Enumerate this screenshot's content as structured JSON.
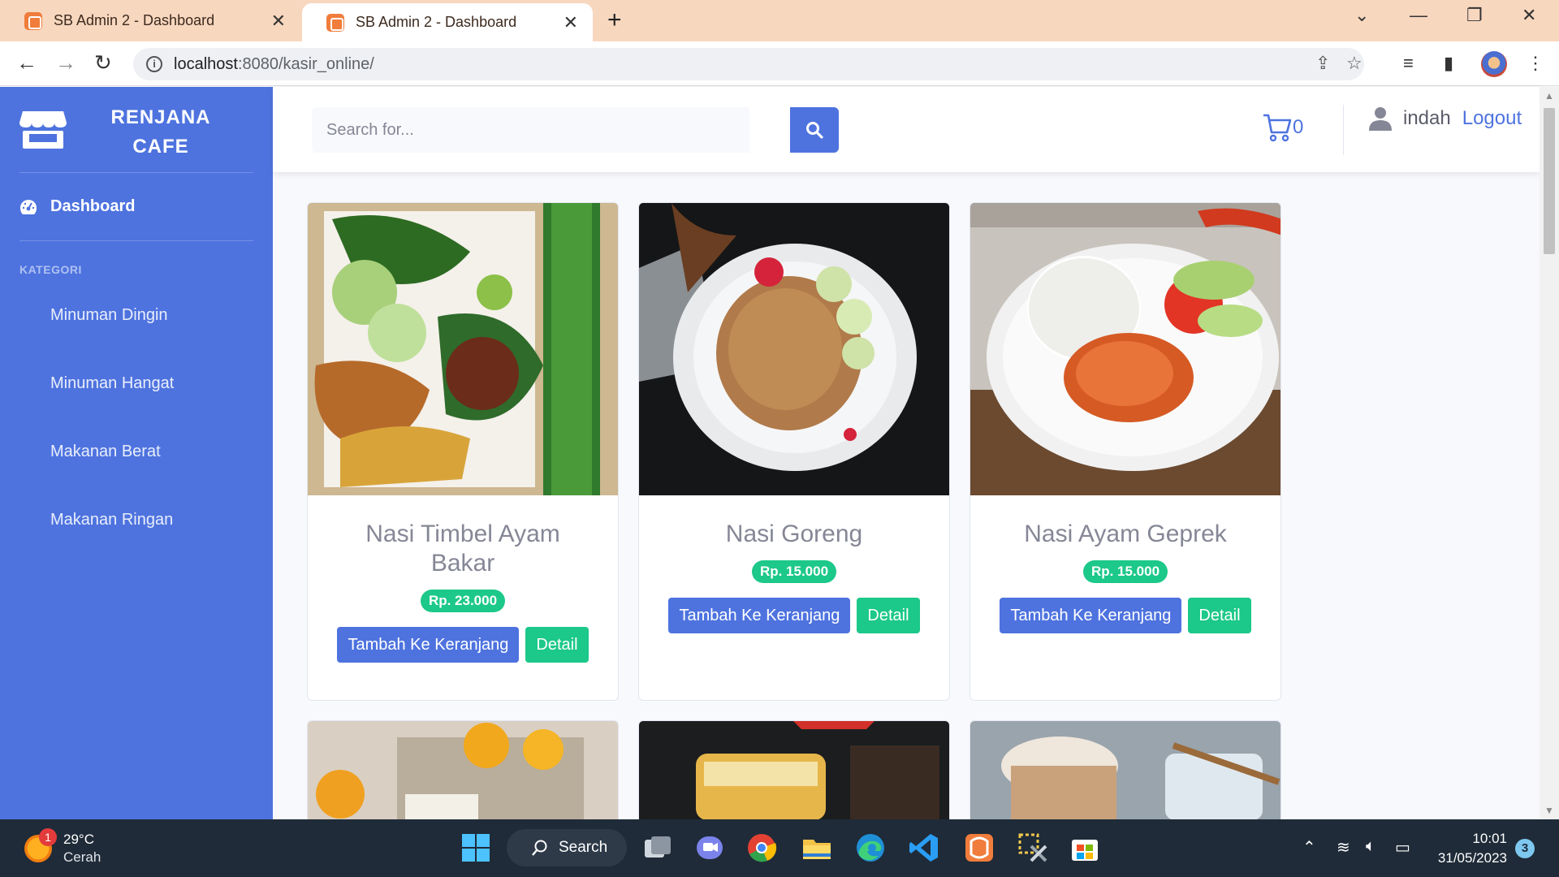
{
  "browser": {
    "tabs": [
      {
        "label": "SB Admin 2 - Dashboard"
      },
      {
        "label": "SB Admin 2 - Dashboard"
      }
    ],
    "url_host": "localhost",
    "url_rest": ":8080/kasir_online/"
  },
  "sidebar": {
    "brand_line1": "RENJANA",
    "brand_line2": "CAFE",
    "dashboard_label": "Dashboard",
    "heading": "KATEGORI",
    "categories": [
      {
        "label": "Minuman Dingin"
      },
      {
        "label": "Minuman Hangat"
      },
      {
        "label": "Makanan Berat"
      },
      {
        "label": "Makanan Ringan"
      }
    ]
  },
  "topbar": {
    "search_placeholder": "Search for...",
    "cart_count": "0",
    "username": "indah",
    "logout_label": "Logout"
  },
  "products": [
    {
      "name": "Nasi Timbel Ayam Bakar",
      "price": "Rp. 23.000",
      "add_label": "Tambah Ke Keranjang",
      "detail_label": "Detail"
    },
    {
      "name": "Nasi Goreng",
      "price": "Rp. 15.000",
      "add_label": "Tambah Ke Keranjang",
      "detail_label": "Detail"
    },
    {
      "name": "Nasi Ayam Geprek",
      "price": "Rp. 15.000",
      "add_label": "Tambah Ke Keranjang",
      "detail_label": "Detail"
    }
  ],
  "taskbar": {
    "weather_notifications": "1",
    "temperature": "29°C",
    "condition": "Cerah",
    "search_label": "Search",
    "time": "10:01",
    "date": "31/05/2023",
    "notification_count": "3"
  },
  "colors": {
    "primary": "#4e73df",
    "success": "#1cc88a",
    "tabbar": "#f8d7bf",
    "taskbar": "#1f2b38"
  }
}
